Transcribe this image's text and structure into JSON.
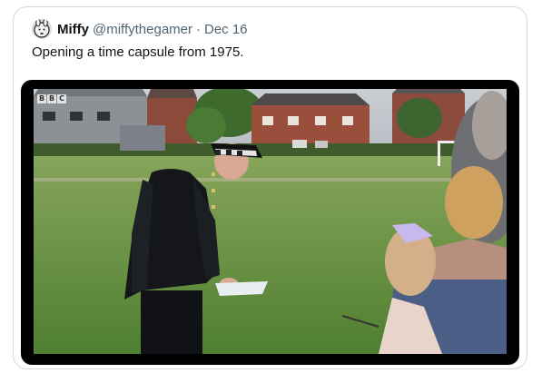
{
  "tweet": {
    "author_name": "Miffy",
    "handle": "@miffythegamer",
    "separator": "·",
    "date": "Dec 16",
    "text": "Opening a time capsule from 1975."
  },
  "media": {
    "broadcaster_logo": [
      "B",
      "B",
      "C"
    ]
  },
  "colors": {
    "text_primary": "#0f1419",
    "text_secondary": "#536471",
    "border": "#cfd9de",
    "grass": "#5d8a3a"
  }
}
